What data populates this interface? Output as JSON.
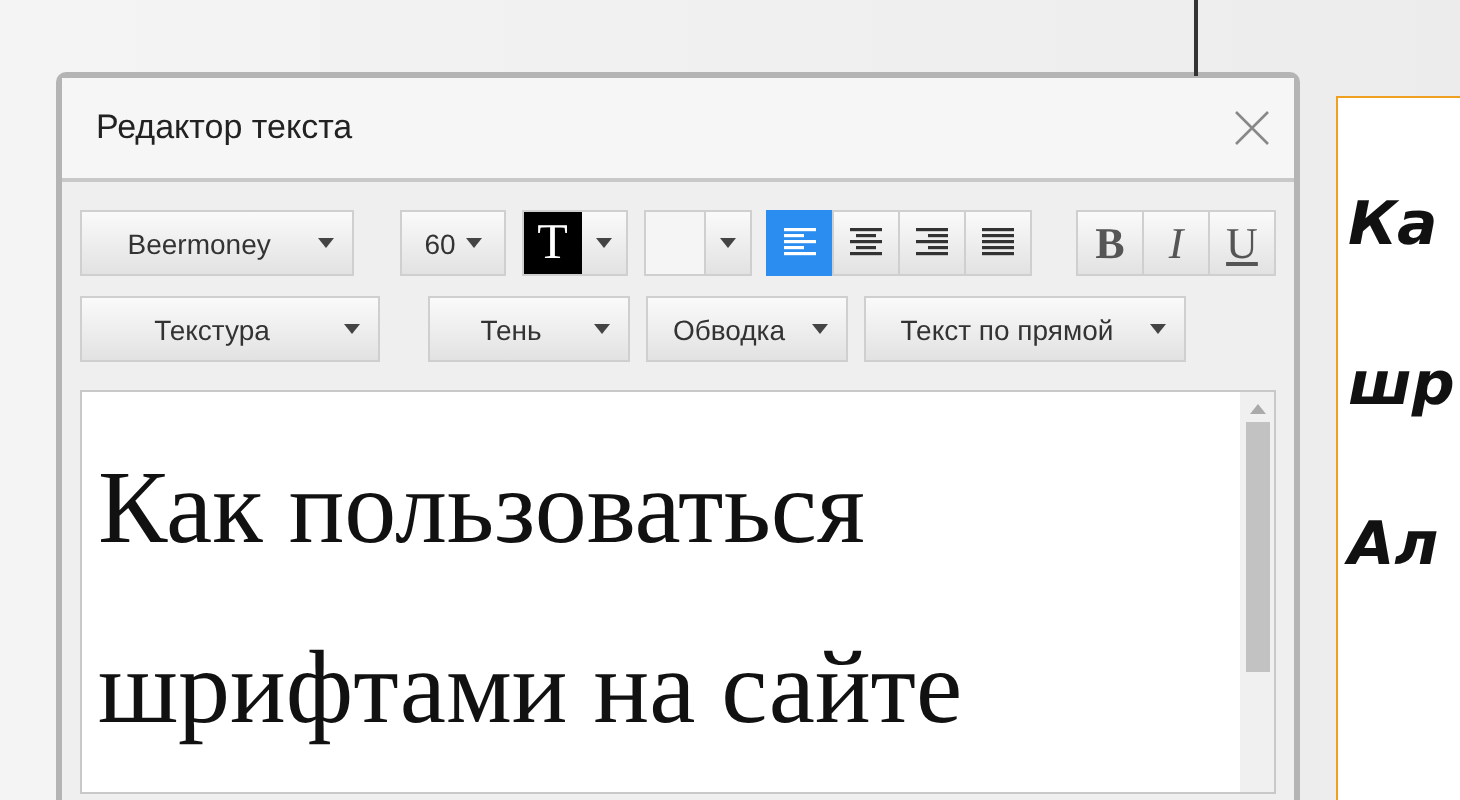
{
  "dialog": {
    "title": "Редактор текста"
  },
  "toolbar_row_1": {
    "font": {
      "value": "Beermoney"
    },
    "size": {
      "value": "60"
    },
    "text_color": {
      "glyph": "T",
      "color": "#000000"
    },
    "alignment": [
      {
        "kind": "left",
        "selected": true
      },
      {
        "kind": "center",
        "selected": false
      },
      {
        "kind": "right",
        "selected": false
      },
      {
        "kind": "justify",
        "selected": false
      }
    ],
    "styles": [
      {
        "kind": "bold",
        "label": "B",
        "on": false
      },
      {
        "kind": "italic",
        "label": "I",
        "on": false
      },
      {
        "kind": "underline",
        "label": "U",
        "on": false
      }
    ]
  },
  "toolbar_row_2": [
    {
      "label": "Текстура"
    },
    {
      "label": "Тень"
    },
    {
      "label": "Обводка"
    },
    {
      "label": "Текст по прямой"
    }
  ],
  "editor": {
    "lines": [
      "Как пользоваться",
      "шрифтами на сайте"
    ]
  },
  "preview": {
    "lines": [
      "Ка",
      "шр",
      "Ал"
    ]
  }
}
